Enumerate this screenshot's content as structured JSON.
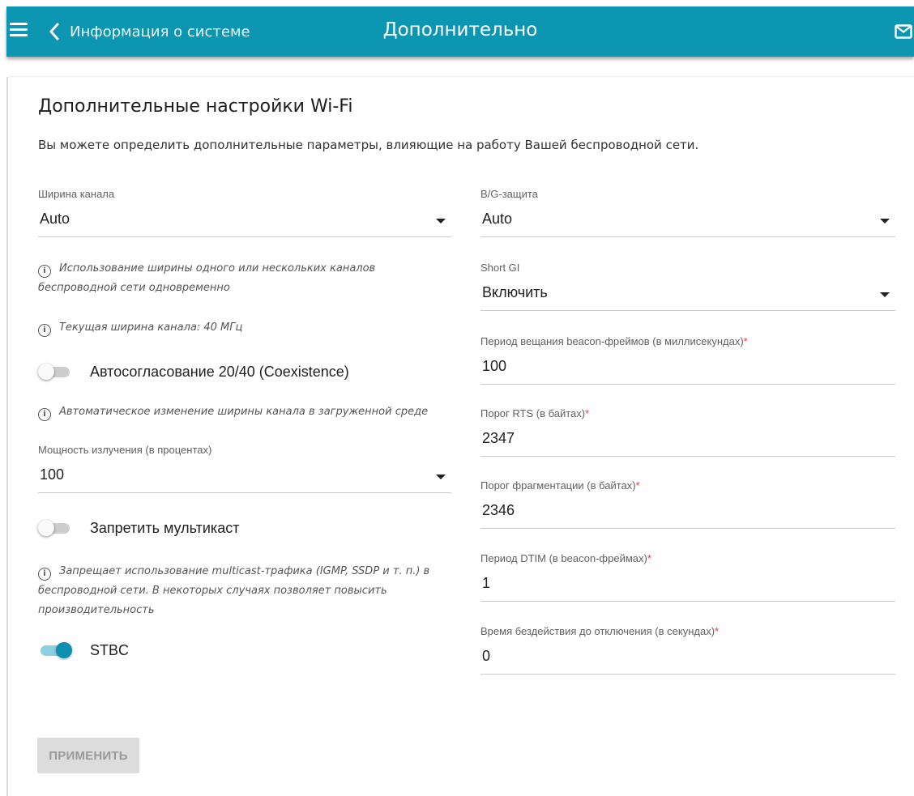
{
  "header": {
    "back_label": "Информация о системе",
    "title": "Дополнительно",
    "accent_color": "#0d96b2"
  },
  "section": {
    "title": "Дополнительные настройки Wi-Fi",
    "description": "Вы можете определить дополнительные параметры, влияющие на работу Вашей беспроводной сети."
  },
  "left": {
    "channel_width": {
      "label": "Ширина канала",
      "value": "Auto"
    },
    "hint_channel_usage": "Использование ширины одного или нескольких каналов беспроводной сети одновременно",
    "hint_current_width": "Текущая ширина канала: 40 МГц",
    "coexistence": {
      "label": "Автосогласование 20/40 (Coexistence)",
      "enabled": false
    },
    "hint_coexistence": "Автоматическое изменение ширины канала в загруженной среде",
    "tx_power": {
      "label": "Мощность излучения (в процентах)",
      "value": "100"
    },
    "block_multicast": {
      "label": "Запретить мультикаст",
      "enabled": false
    },
    "hint_multicast": "Запрещает использование multicast-трафика (IGMP, SSDP и т. п.) в беспроводной сети. В некоторых случаях позволяет повысить производительность",
    "stbc": {
      "label": "STBC",
      "enabled": true
    }
  },
  "right": {
    "bg_protection": {
      "label": "B/G-защита",
      "value": "Auto"
    },
    "short_gi": {
      "label": "Short GI",
      "value": "Включить"
    },
    "beacon_period": {
      "label": "Период вещания beacon-фреймов (в миллисекундах)",
      "required": "*",
      "value": "100"
    },
    "rts_threshold": {
      "label": "Порог RTS (в байтах)",
      "required": "*",
      "value": "2347"
    },
    "frag_threshold": {
      "label": "Порог фрагментации (в байтах)",
      "required": "*",
      "value": "2346"
    },
    "dtim_period": {
      "label": "Период DTIM (в beacon-фреймах)",
      "required": "*",
      "value": "1"
    },
    "inactivity_timeout": {
      "label": "Время бездействия до отключения (в секундах)",
      "required": "*",
      "value": "0"
    }
  },
  "actions": {
    "apply_label": "ПРИМЕНИТЬ"
  },
  "icons": [
    "hamburger-icon",
    "chevron-left-icon",
    "mail-icon",
    "info-icon",
    "dropdown-caret-icon"
  ]
}
